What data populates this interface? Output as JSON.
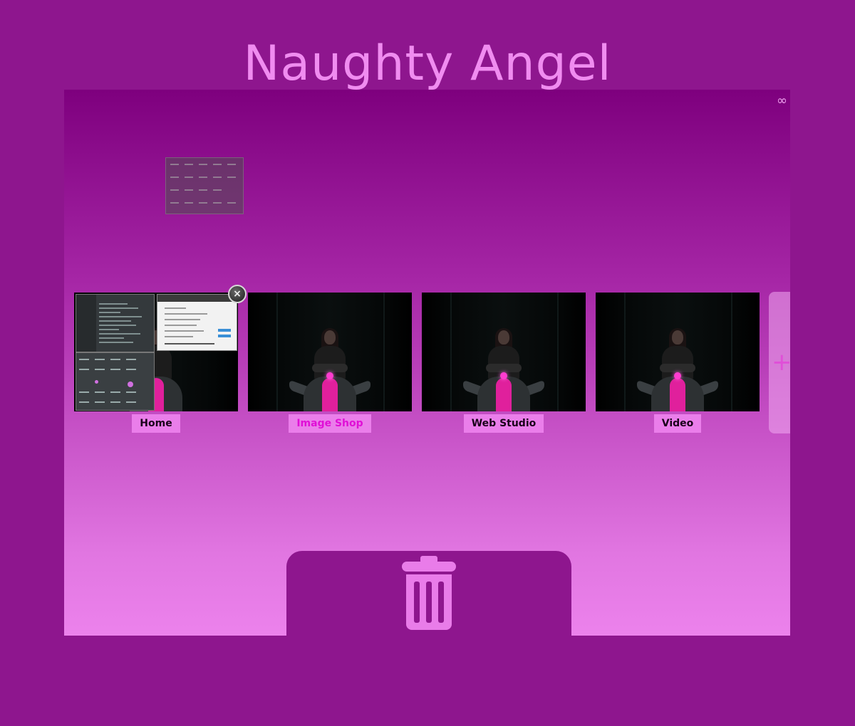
{
  "app": {
    "title": "Naughty Angel"
  },
  "overview": {
    "toggle_icon": "infinity-icon",
    "toggle_glyph": "∞"
  },
  "workspaces": [
    {
      "label": "Home",
      "active": false
    },
    {
      "label": "Image Shop",
      "active": true
    },
    {
      "label": "Web Studio",
      "active": false
    },
    {
      "label": "Video",
      "active": false
    }
  ],
  "close_button": {
    "icon": "close-icon",
    "glyph": "×"
  },
  "add_workspace": {
    "icon": "plus-icon",
    "glyph": "+"
  },
  "trash": {
    "icon": "trash-icon"
  },
  "colors": {
    "background": "#8e168e",
    "title": "#f08cf0",
    "label_bg": "#ea7eea",
    "active_label": "#e00fd6"
  }
}
